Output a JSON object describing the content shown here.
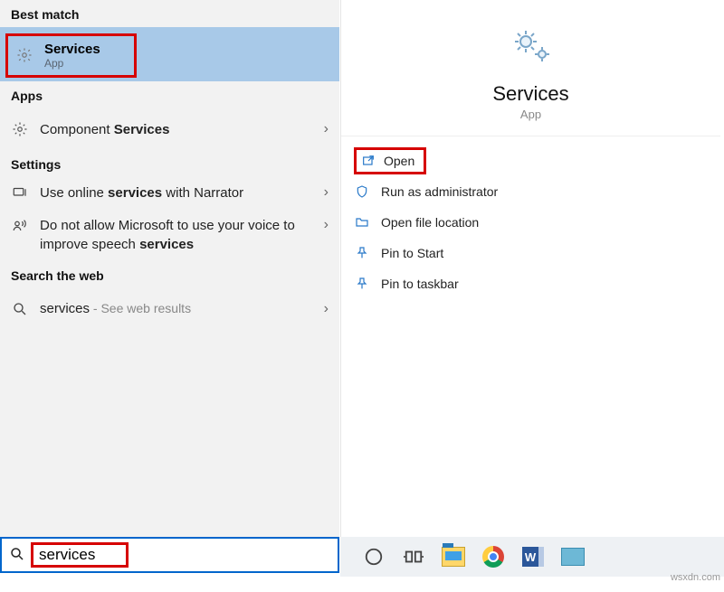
{
  "left": {
    "best_match_header": "Best match",
    "best_match": {
      "title": "Services",
      "subtitle": "App"
    },
    "apps_header": "Apps",
    "apps": [
      {
        "prefix": "Component ",
        "bold": "Services"
      }
    ],
    "settings_header": "Settings",
    "settings": [
      {
        "pre": "Use online ",
        "bold": "services",
        "post": " with Narrator"
      },
      {
        "pre": "Do not allow Microsoft to use your voice to improve speech ",
        "bold": "services",
        "post": ""
      }
    ],
    "web_header": "Search the web",
    "web": {
      "query": "services",
      "hint": " - See web results"
    }
  },
  "right": {
    "title": "Services",
    "subtitle": "App",
    "actions": {
      "open": "Open",
      "run_admin": "Run as administrator",
      "open_location": "Open file location",
      "pin_start": "Pin to Start",
      "pin_taskbar": "Pin to taskbar"
    }
  },
  "search": {
    "value": "services"
  },
  "taskbar": {
    "cortana": "cortana-icon",
    "taskview": "task-view-icon",
    "explorer": "file-explorer-icon",
    "chrome": "chrome-icon",
    "word": "W",
    "misc": "app-icon"
  },
  "watermark": "wsxdn.com"
}
